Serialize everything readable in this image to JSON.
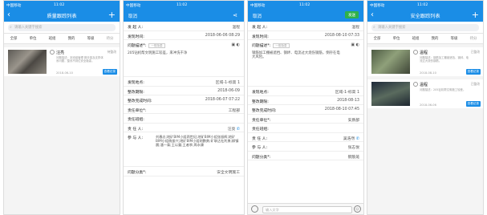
{
  "status_bar": {
    "carrier": "中国移动",
    "time_1": "11:02",
    "time_2": "11:02",
    "time_3": "11:02",
    "time_4": "11:02",
    "battery": "12"
  },
  "quality_list": {
    "title": "质量跟踪列表",
    "search_placeholder": "请输入关键字搜索",
    "tabs": [
      "全部",
      "单位",
      "班组",
      "我的",
      "等级",
      "待分"
    ],
    "card": {
      "name": "汪亮",
      "status": "待整改",
      "desc": "问题描述：本班组管理 脚手架及支撑体系问题，整改不到位安全隐患。",
      "sub": "发起人： 陈生会",
      "date": "2018-06-10",
      "button": "查看记录"
    }
  },
  "detail": {
    "cancel": "取消",
    "send": "发送",
    "initiator_label": "发 起 人:",
    "initiator_value_1": "温程",
    "initiator_value_2": "温程",
    "time_label": "发现时间:",
    "time_value_1": "2018-06-06 08:29",
    "time_value_2": "2018-08-10 07:33",
    "desc_label": "问题描述*:",
    "desc_tag": "一般隐患",
    "desc_text_1": "205钻机帮文明施工较差，来冲洗干净",
    "desc_text_2": "钢筋加工棚被遮挡、钢绊、电流过大烧伤钢筋，倒存在电大风险。",
    "location_label": "发现地点:",
    "location_value": "区域-1-标高 1",
    "deadline_label": "整改期限:",
    "deadline_value_1": "2018-06-09",
    "deadline_value_2": "2018-08-13",
    "finish_label": "整改完成时间:",
    "finish_value_1": "2018-06-07 07:22",
    "finish_value_2": "2018-08-10 07:45",
    "unit_label": "责任单位*:",
    "unit_value_1": "工程部",
    "unit_value_2": "安质部",
    "team_label": "责任班组:",
    "person_label": "责 任 人:",
    "person_value_1": "汪亮",
    "person_value_2": "吴浩然",
    "participant_label": "参 与 人:",
    "participant_value_1": "刘春志;地矿BIM小组两世纪;地矿BIM小组张振辉;地矿BIM小组杨振兴;地矿BIM小组胡鹏勇;矿联达杜利勇;柳镇晨;潘一泰;王以童;王者季;周永康",
    "participant_value_2": "张志悦",
    "category_label": "问题分类*:",
    "category_value_1": "安全文明施工",
    "category_value_2": "钢筋笼",
    "input_placeholder": "输入文字"
  },
  "safety_list": {
    "title": "安全跟踪列表",
    "search_placeholder": "请输入关键字搜索",
    "tabs": [
      "全部",
      "单位",
      "班组",
      "我的",
      "等级",
      "待分"
    ],
    "cards": [
      {
        "name": "温程",
        "status": "已整改",
        "desc": "问题描述：钢筋加工棚被遮挡、钢绊、电流过大烧伤钢筋。",
        "date": "2018-08-10",
        "button": "查看记录"
      },
      {
        "name": "温程",
        "status": "已整改",
        "desc": "问题描述：205钻机帮文明施工较差。",
        "date": "2018-06-06",
        "button": "查看记录"
      }
    ]
  }
}
